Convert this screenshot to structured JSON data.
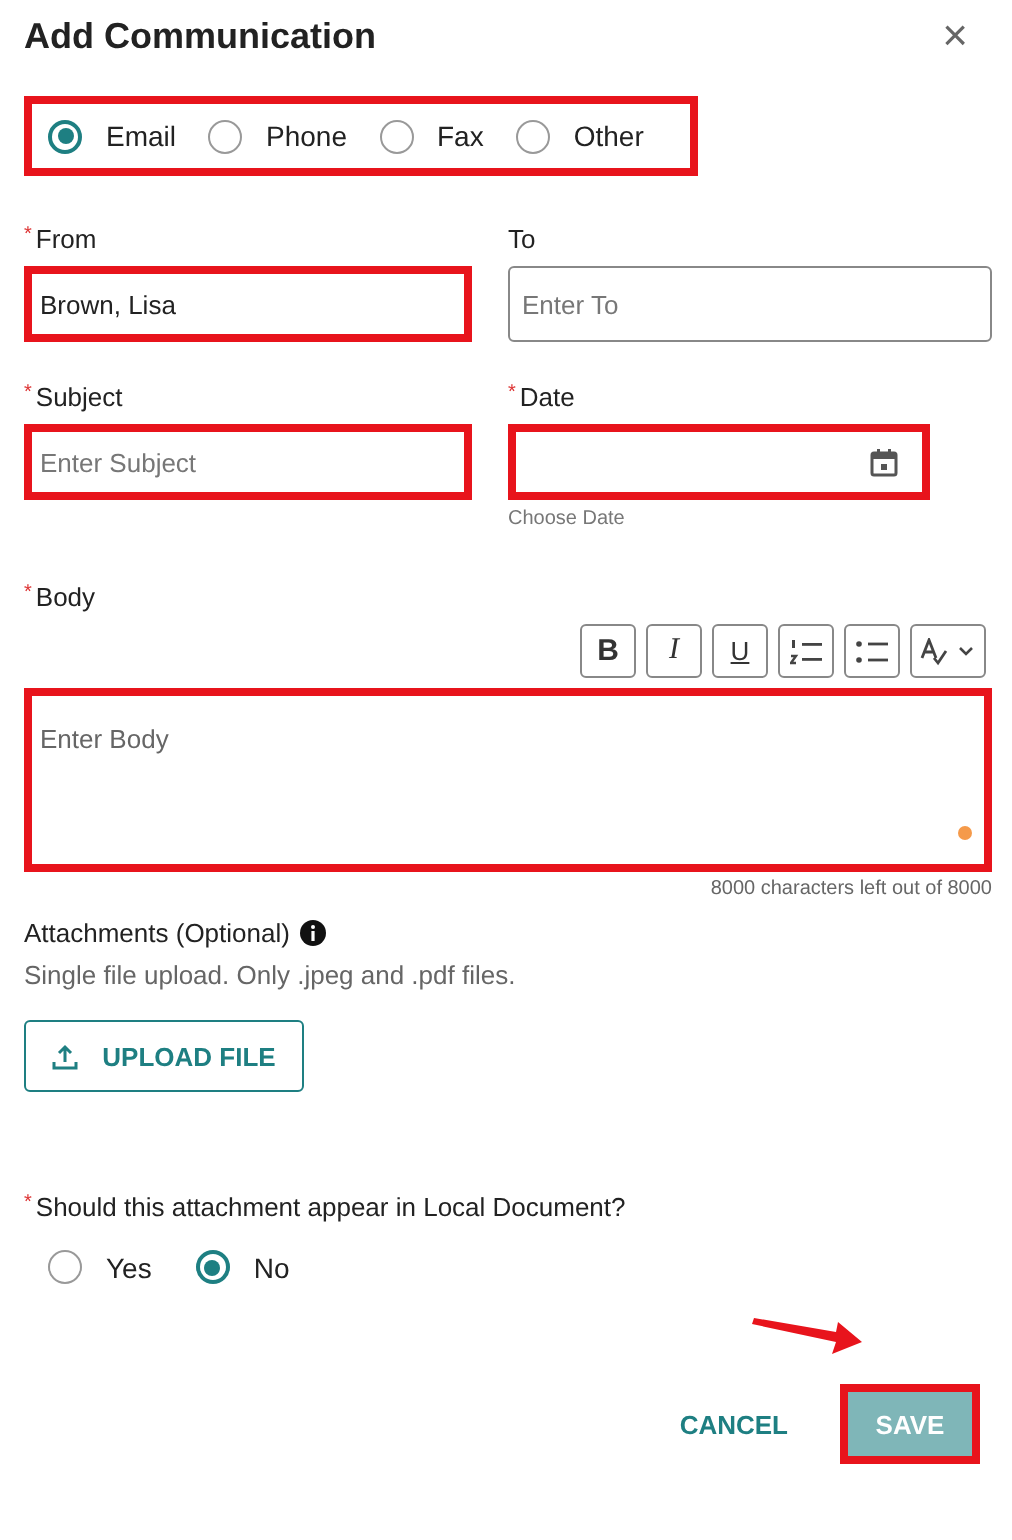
{
  "dialog": {
    "title": "Add Communication",
    "close": "×"
  },
  "type_options": {
    "highlighted": true,
    "options": [
      {
        "label": "Email",
        "selected": true
      },
      {
        "label": "Phone",
        "selected": false
      },
      {
        "label": "Fax",
        "selected": false
      },
      {
        "label": "Other",
        "selected": false
      }
    ]
  },
  "rows": [
    [
      {
        "kind": "text",
        "marker": "*",
        "label": "From",
        "value": "Brown, Lisa",
        "highlighted": true
      },
      {
        "kind": "text",
        "label": "To",
        "placeholder": "Enter To",
        "highlighted": false
      }
    ],
    [
      {
        "kind": "text",
        "marker": "*",
        "label": "Subject",
        "placeholder": "Enter Subject",
        "highlighted": true
      },
      {
        "kind": "date",
        "marker": "*",
        "label": "Date",
        "hint": "Choose Date",
        "highlighted": true
      }
    ]
  ],
  "body": {
    "marker": "*",
    "label": "Body",
    "placeholder": "Enter Body",
    "highlighted": true,
    "counter": "8000 characters left out of 8000",
    "toolbar": [
      {
        "kind": "bold",
        "label": "B"
      },
      {
        "kind": "italic",
        "label": "I"
      },
      {
        "kind": "underline",
        "label": "U"
      },
      {
        "kind": "ordered-list"
      },
      {
        "kind": "bullet-list"
      },
      {
        "kind": "spellcheck"
      }
    ]
  },
  "attachments": {
    "label": "Attachments (Optional)",
    "hint": "Single file upload. Only .jpeg and .pdf files.",
    "button": "UPLOAD FILE"
  },
  "local_document": {
    "marker": "*",
    "question": "Should this attachment appear in Local Document?",
    "options": [
      {
        "label": "Yes",
        "selected": false
      },
      {
        "label": "No",
        "selected": true
      }
    ]
  },
  "actions": [
    {
      "kind": "text",
      "label": "CANCEL",
      "disabled": false,
      "highlighted": false,
      "pointed": false
    },
    {
      "kind": "filled",
      "label": "SAVE",
      "disabled": true,
      "highlighted": true,
      "pointed": true
    }
  ]
}
